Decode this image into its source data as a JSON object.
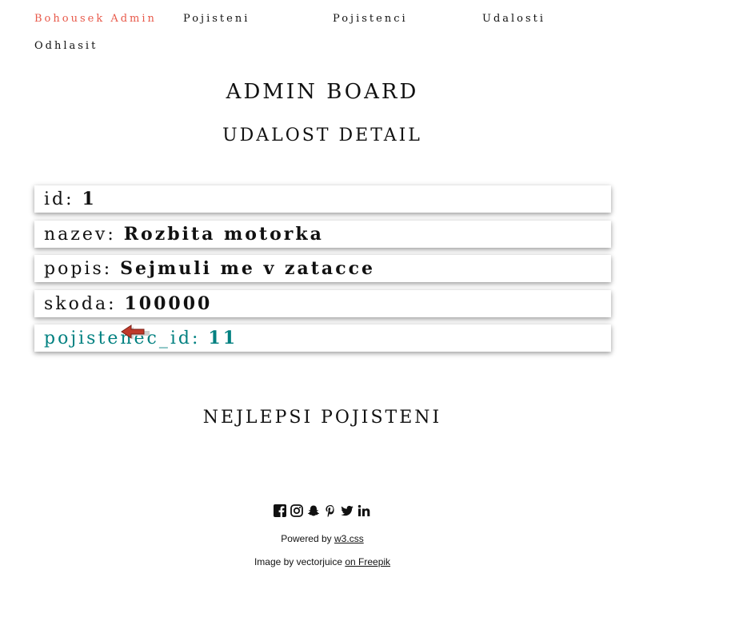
{
  "nav": {
    "brand": "Bohousek Admin",
    "items": [
      "Pojisteni",
      "Pojistenci",
      "Udalosti",
      "Odhlasit"
    ]
  },
  "page": {
    "title": "ADMIN BOARD",
    "subtitle": "UDALOST DETAIL",
    "section": "NEJLEPSI POJISTENI"
  },
  "fields": [
    {
      "label": "id:",
      "value": "1"
    },
    {
      "label": "nazev:",
      "value": "Rozbita motorka"
    },
    {
      "label": "popis:",
      "value": "Sejmuli me v zatacce"
    },
    {
      "label": "skoda:",
      "value": "100000"
    },
    {
      "label": "pojistenec_id:",
      "value": "11"
    }
  ],
  "footer": {
    "social_icons": [
      "facebook-icon",
      "instagram-icon",
      "snapchat-icon",
      "pinterest-icon",
      "twitter-icon",
      "linkedin-icon"
    ],
    "powered_prefix": "Powered by",
    "powered_link": "w3.css",
    "image_prefix": "Image by vectorjuice",
    "image_link": "on Freepik"
  },
  "colors": {
    "brand": "#e8594a",
    "link_field": "#008080"
  }
}
